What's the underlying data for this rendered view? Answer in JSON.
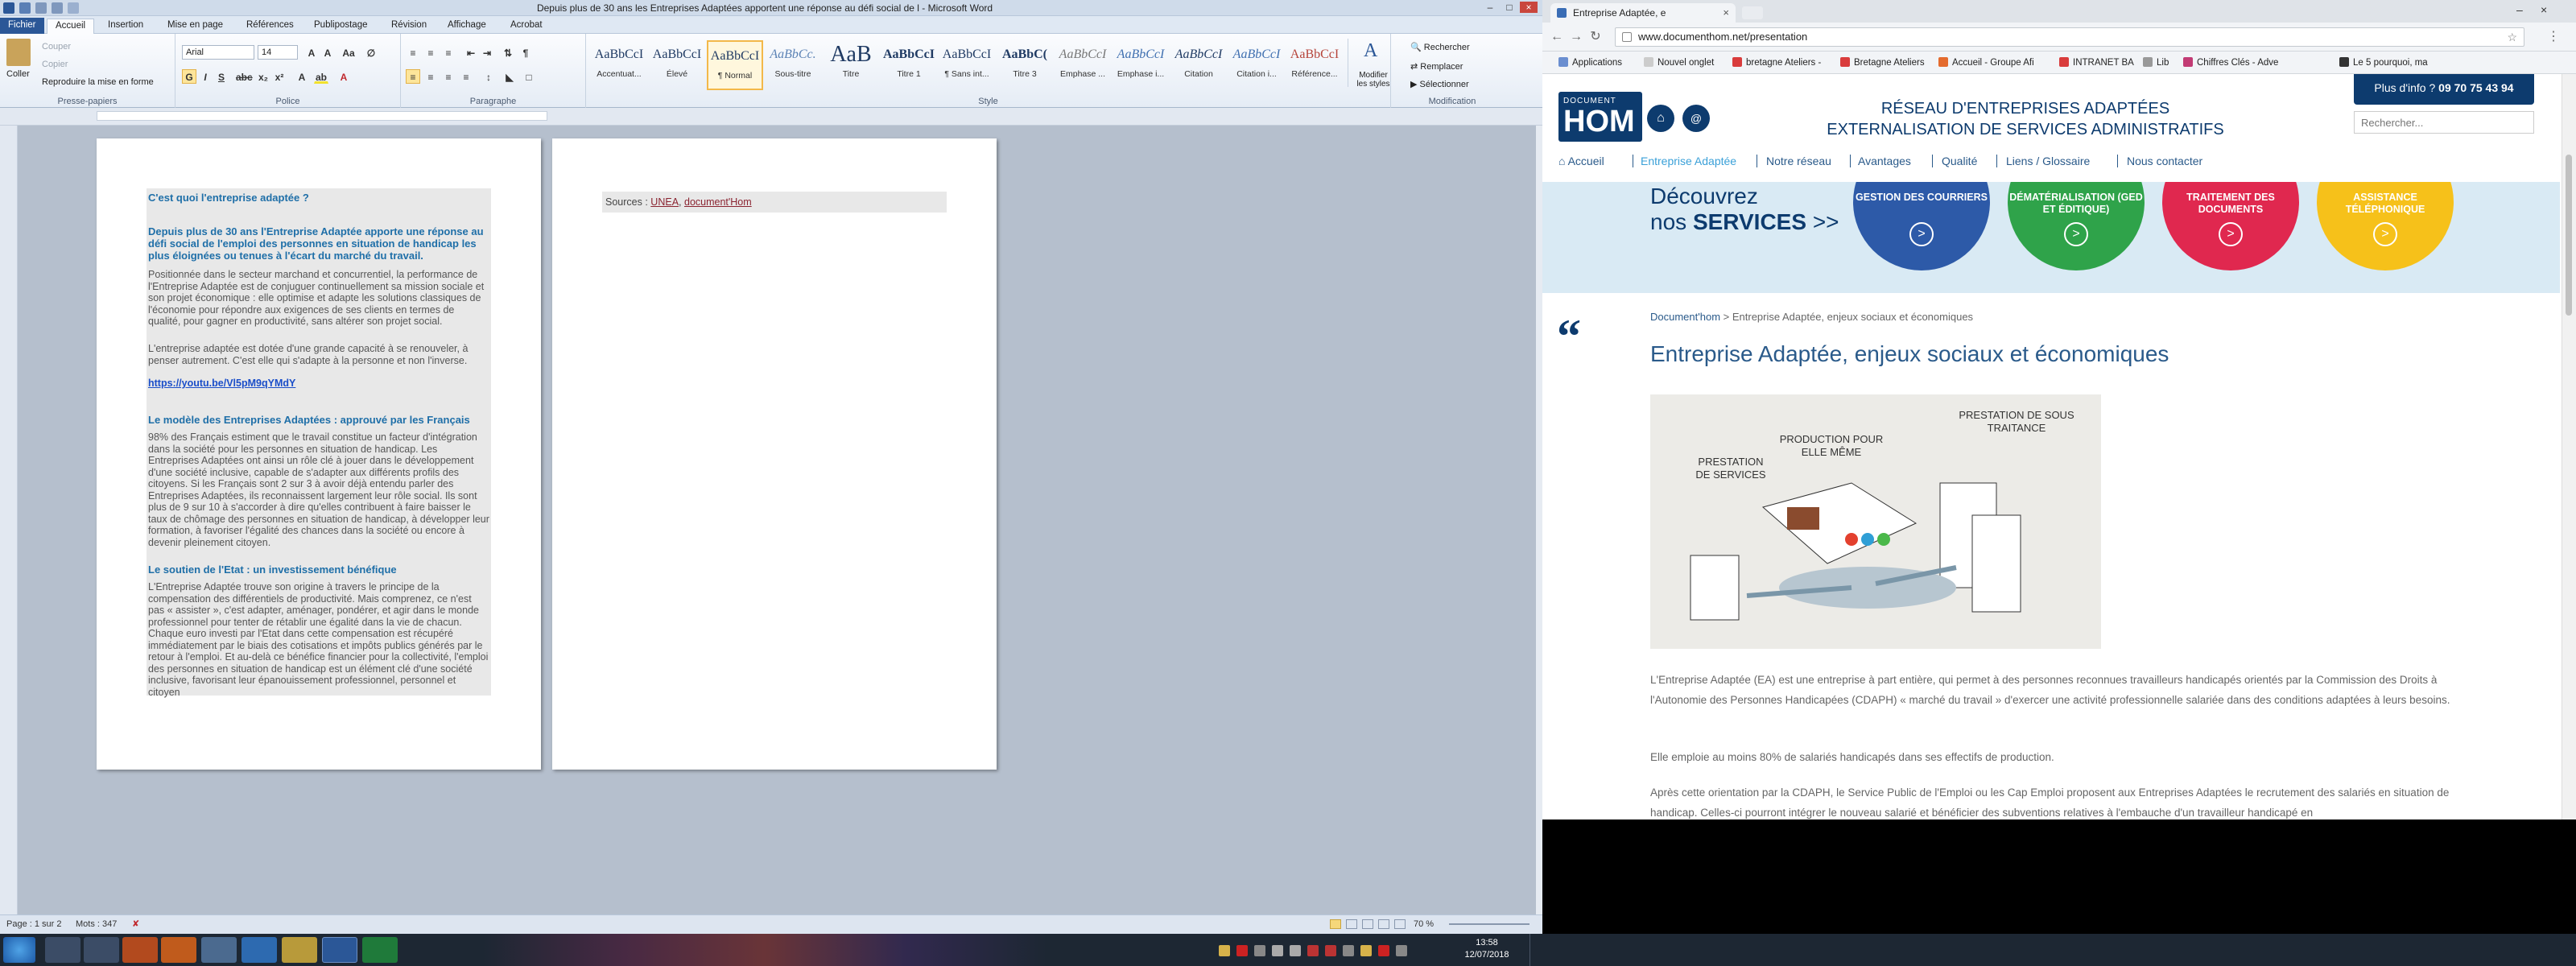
{
  "word": {
    "title": "Depuis plus de 30 ans les Entreprises Adaptées apportent une réponse au défi social de l - Microsoft Word",
    "tabs": [
      "Fichier",
      "Accueil",
      "Insertion",
      "Mise en page",
      "Références",
      "Publipostage",
      "Révision",
      "Affichage",
      "Acrobat"
    ],
    "clipboard": {
      "paste": "Coller",
      "cut": "Couper",
      "copy": "Copier",
      "format_painter": "Reproduire la mise en forme",
      "label": "Presse-papiers"
    },
    "police": {
      "font": "Arial",
      "size": "14",
      "label": "Police"
    },
    "paragraphe_label": "Paragraphe",
    "styles": [
      {
        "preview": "AaBbCcI",
        "name": "Accentuat..."
      },
      {
        "preview": "AaBbCcI",
        "name": "Élevé"
      },
      {
        "preview": "AaBbCcI",
        "name": "¶ Normal"
      },
      {
        "preview": "AaBbCc.",
        "name": "Sous-titre"
      },
      {
        "preview": "AaB",
        "name": "Titre"
      },
      {
        "preview": "AaBbCcI",
        "name": "Titre 1"
      },
      {
        "preview": "AaBbCcI",
        "name": "¶ Sans int..."
      },
      {
        "preview": "AaBbC(",
        "name": "Titre 3"
      },
      {
        "preview": "AaBbCcI",
        "name": "Emphase ..."
      },
      {
        "preview": "AaBbCcI",
        "name": "Emphase i..."
      },
      {
        "preview": "AaBbCcI",
        "name": "Citation"
      },
      {
        "preview": "AaBbCcI",
        "name": "Citation i..."
      },
      {
        "preview": "AaBbCcI",
        "name": "Référence..."
      }
    ],
    "styles_label": "Style",
    "change_styles": "Modifier les styles",
    "edit": {
      "find": "Rechercher",
      "replace": "Remplacer",
      "select": "Sélectionner",
      "label": "Modification"
    },
    "page1": {
      "h1": "C'est quoi l'entreprise adaptée ?",
      "h2": "Depuis plus de 30 ans l'Entreprise Adaptée apporte une réponse au défi social de l'emploi des personnes en situation de handicap les plus éloignées ou tenues à l'écart du marché du travail.",
      "p1": "Positionnée dans le secteur marchand et concurrentiel, la performance de l'Entreprise Adaptée est de conjuguer continuellement sa mission sociale et son projet économique : elle optimise et adapte les solutions classiques de l'économie pour répondre aux exigences de ses clients en termes de qualité, pour gagner en productivité, sans altérer son projet social.",
      "p2": "L'entreprise adaptée est dotée d'une grande capacité à se renouveler, à penser autrement. C'est elle qui s'adapte à la personne et non l'inverse.",
      "link": "https://youtu.be/Vl5pM9qYMdY",
      "h3": "Le modèle des Entreprises Adaptées : approuvé par les Français",
      "p3": "98% des Français estiment que le travail constitue un facteur d'intégration dans la société pour les personnes en situation de handicap. Les Entreprises Adaptées ont ainsi un rôle clé à jouer dans le développement d'une société inclusive, capable de s'adapter aux différents profils des citoyens. Si les Français sont 2 sur 3 à avoir déjà entendu parler des Entreprises Adaptées, ils reconnaissent largement leur rôle social. Ils sont plus de 9 sur 10 à s'accorder à dire qu'elles contribuent à faire baisser le taux de chômage des personnes en situation de handicap, à développer leur formation, à favoriser l'égalité des chances dans la société ou encore à devenir pleinement citoyen.",
      "h4": "Le soutien de l'Etat : un investissement bénéfique",
      "p4": "L'Entreprise Adaptée trouve son origine à travers le principe de la compensation des différentiels de productivité. Mais comprenez, ce n'est pas « assister », c'est adapter, aménager, pondérer, et agir dans le monde professionnel pour tenter de rétablir une égalité dans la vie de chacun. Chaque euro investi par l'Etat dans cette compensation est récupéré immédiatement par le biais des cotisations et impôts publics générés par le retour à l'emploi. Et au-delà ce bénéfice financier pour la collectivité, l'emploi des personnes en situation de handicap est un élément clé d'une société inclusive, favorisant leur épanouissement professionnel, personnel et citoyen"
    },
    "page2": {
      "sources_label": "Sources :",
      "src1": "UNEA",
      "sep": ",",
      "src2": "document'Hom"
    },
    "status": {
      "page": "Page : 1 sur 2",
      "words": "Mots : 347",
      "zoom": "70 %"
    }
  },
  "chrome": {
    "tab_title": "Entreprise Adaptée, e",
    "url": "www.documenthom.net/presentation",
    "bookmarks": [
      "Applications",
      "Nouvel onglet",
      "bretagne Ateliers -",
      "Bretagne Ateliers",
      "Accueil - Groupe Afi",
      "INTRANET BA",
      "Lib",
      "Chiffres Clés - Adve",
      "Le 5 pourquoi, ma"
    ],
    "site": {
      "logo_small": "DOCUMENT",
      "logo_big": "HOM",
      "header1": "RÉSEAU D'ENTREPRISES ADAPTÉES",
      "header2": "EXTERNALISATION DE SERVICES ADMINISTRATIFS",
      "phone_label": "Plus d'info ?",
      "phone": "09 70 75 43 94",
      "search_placeholder": "Rechercher...",
      "nav": [
        "Accueil",
        "Entreprise Adaptée",
        "Notre réseau",
        "Avantages",
        "Qualité",
        "Liens / Glossaire",
        "Nous contacter"
      ],
      "banner_l1": "Découvrez",
      "banner_l2a": "nos",
      "banner_l2b": "SERVICES",
      "banner_arrows": ">>",
      "services": [
        "GESTION DES COURRIERS",
        "DÉMATÉRIALISATION (GED ET ÉDITIQUE)",
        "TRAITEMENT DES DOCUMENTS",
        "ASSISTANCE TÉLÉPHONIQUE"
      ],
      "service_colors": [
        "#2d5aa8",
        "#2fa34a",
        "#e0284f",
        "#f6c11a"
      ],
      "breadcrumb_home": "Document'hom",
      "breadcrumb_current": "> Entreprise Adaptée, enjeux sociaux et économiques",
      "page_title": "Entreprise Adaptée, enjeux sociaux et économiques",
      "illustration_labels": [
        "PRESTATION DE SOUS TRAITANCE",
        "PRODUCTION POUR ELLE MÊME",
        "PRESTATION DE SERVICES"
      ],
      "p1": "L'Entreprise Adaptée (EA) est une entreprise à part entière, qui permet à des personnes reconnues travailleurs handicapés orientés par la Commission des Droits à l'Autonomie des Personnes Handicapées (CDAPH) « marché du travail » d'exercer une activité professionnelle salariée dans des conditions adaptées à leurs besoins.",
      "p2": "Elle emploie au moins 80% de salariés handicapés dans ses effectifs de production.",
      "p3": "Après cette orientation par la CDAPH, le Service Public de l'Emploi ou les Cap Emploi proposent aux Entreprises Adaptées le recrutement des salariés en situation de handicap. Celles-ci pourront intégrer le nouveau salarié et bénéficier des subventions relatives à l'embauche d'un travailleur handicapé en"
    }
  },
  "taskbar": {
    "time": "13:58",
    "date": "12/07/2018"
  }
}
